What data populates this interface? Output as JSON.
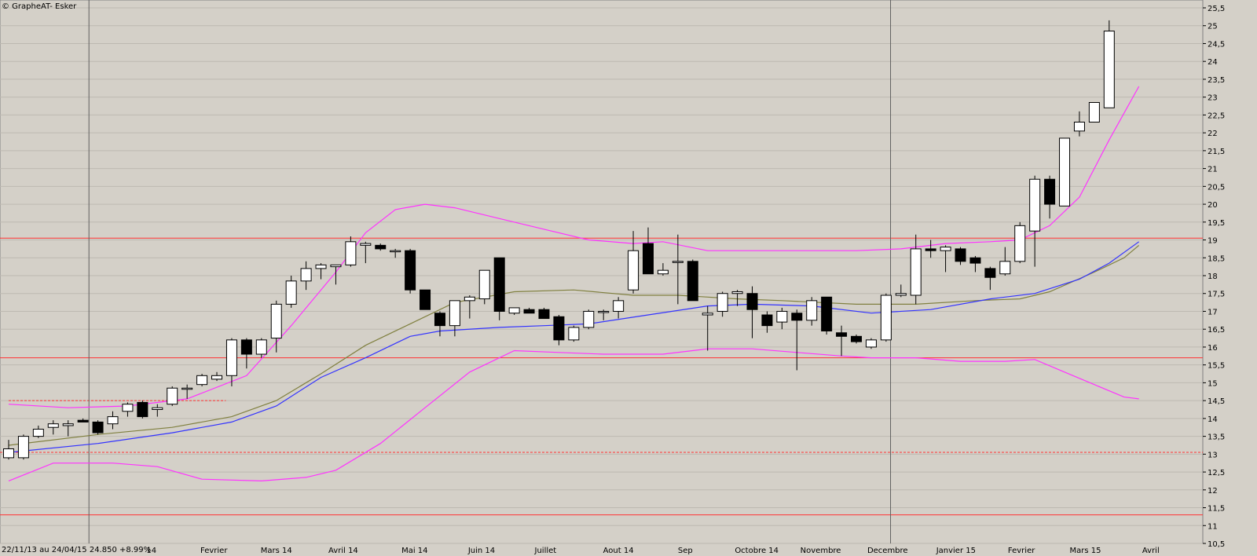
{
  "chart_data": {
    "type": "candlestick",
    "title": "© GrapheAT- Esker",
    "footer_info": "22/11/13 au 24/04/15  24.850  +8.99%",
    "ylim": [
      10.5,
      25.5
    ],
    "y_tick_labels": [
      "10,5",
      "11",
      "11,5",
      "12",
      "12,5",
      "13",
      "13,5",
      "14",
      "14,5",
      "15",
      "15,5",
      "16",
      "16,5",
      "17",
      "17,5",
      "18",
      "18,5",
      "19",
      "19,5",
      "20",
      "20,5",
      "21",
      "21,5",
      "22",
      "22,5",
      "23",
      "23,5",
      "24",
      "24,5",
      "25",
      "25,5"
    ],
    "y_ticks": [
      10.5,
      11,
      11.5,
      12,
      12.5,
      13,
      13.5,
      14,
      14.5,
      15,
      15.5,
      16,
      16.5,
      17,
      17.5,
      18,
      18.5,
      19,
      19.5,
      20,
      20.5,
      21,
      21.5,
      22,
      22.5,
      23,
      23.5,
      24,
      24.5,
      25,
      25.5
    ],
    "x_tick_labels": [
      "14",
      "Fevrier",
      "Mars 14",
      "Avril 14",
      "Mai 14",
      "Juin 14",
      "Juillet",
      "Aout 14",
      "Sep",
      "Octobre 14",
      "Novembre",
      "Decembre",
      "Janvier 15",
      "Fevrier",
      "Mars 15",
      "Avril"
    ],
    "x_tick_index": [
      9.6,
      13.8,
      18,
      22.5,
      27.3,
      31.8,
      36.1,
      41,
      45.5,
      50.3,
      54.6,
      59.1,
      63.7,
      68.1,
      72.4,
      76.8
    ],
    "grid": true,
    "colors": {
      "background": "#d4d0c8",
      "grid": "#bdb9b1",
      "up_candle": "#ffffff",
      "down_candle": "#000000",
      "bollinger": "#ff33ff",
      "ma_short": "#3333ff",
      "ma_long": "#808040",
      "support_line": "#ff3333",
      "separator": "#606060"
    },
    "candles": [
      {
        "o": 12.9,
        "h": 13.4,
        "l": 12.85,
        "c": 13.15
      },
      {
        "o": 12.9,
        "h": 13.55,
        "l": 12.85,
        "c": 13.5
      },
      {
        "o": 13.5,
        "h": 13.8,
        "l": 13.45,
        "c": 13.7
      },
      {
        "o": 13.75,
        "h": 13.95,
        "l": 13.55,
        "c": 13.85
      },
      {
        "o": 13.8,
        "h": 13.95,
        "l": 13.5,
        "c": 13.85
      },
      {
        "o": 13.95,
        "h": 14.0,
        "l": 13.9,
        "c": 13.9
      },
      {
        "o": 13.9,
        "h": 13.95,
        "l": 13.55,
        "c": 13.6
      },
      {
        "o": 13.85,
        "h": 14.2,
        "l": 13.7,
        "c": 14.05
      },
      {
        "o": 14.2,
        "h": 14.45,
        "l": 14.05,
        "c": 14.4
      },
      {
        "o": 14.45,
        "h": 14.5,
        "l": 14.0,
        "c": 14.05
      },
      {
        "o": 14.25,
        "h": 14.4,
        "l": 14.05,
        "c": 14.3
      },
      {
        "o": 14.4,
        "h": 14.9,
        "l": 14.35,
        "c": 14.85
      },
      {
        "o": 14.85,
        "h": 14.95,
        "l": 14.55,
        "c": 14.85
      },
      {
        "o": 14.95,
        "h": 15.25,
        "l": 14.9,
        "c": 15.2
      },
      {
        "o": 15.1,
        "h": 15.3,
        "l": 15.05,
        "c": 15.2
      },
      {
        "o": 15.2,
        "h": 16.25,
        "l": 14.9,
        "c": 16.2
      },
      {
        "o": 16.2,
        "h": 16.25,
        "l": 15.4,
        "c": 15.8
      },
      {
        "o": 15.8,
        "h": 16.25,
        "l": 15.7,
        "c": 16.2
      },
      {
        "o": 16.25,
        "h": 17.3,
        "l": 15.85,
        "c": 17.2
      },
      {
        "o": 17.2,
        "h": 18.0,
        "l": 17.1,
        "c": 17.85
      },
      {
        "o": 17.85,
        "h": 18.4,
        "l": 17.6,
        "c": 18.2
      },
      {
        "o": 18.2,
        "h": 18.35,
        "l": 17.9,
        "c": 18.3
      },
      {
        "o": 18.25,
        "h": 18.3,
        "l": 17.75,
        "c": 18.3
      },
      {
        "o": 18.3,
        "h": 19.1,
        "l": 18.25,
        "c": 18.95
      },
      {
        "o": 18.85,
        "h": 18.95,
        "l": 18.35,
        "c": 18.9
      },
      {
        "o": 18.85,
        "h": 18.9,
        "l": 18.7,
        "c": 18.75
      },
      {
        "o": 18.7,
        "h": 18.75,
        "l": 18.5,
        "c": 18.7
      },
      {
        "o": 18.7,
        "h": 18.75,
        "l": 17.5,
        "c": 17.6
      },
      {
        "o": 17.6,
        "h": 17.6,
        "l": 17.05,
        "c": 17.05
      },
      {
        "o": 16.95,
        "h": 17.0,
        "l": 16.3,
        "c": 16.6
      },
      {
        "o": 16.6,
        "h": 17.3,
        "l": 16.3,
        "c": 17.3
      },
      {
        "o": 17.3,
        "h": 17.45,
        "l": 16.8,
        "c": 17.4
      },
      {
        "o": 17.35,
        "h": 18.15,
        "l": 17.2,
        "c": 18.15
      },
      {
        "o": 18.5,
        "h": 18.5,
        "l": 16.75,
        "c": 17.0
      },
      {
        "o": 16.95,
        "h": 17.1,
        "l": 16.9,
        "c": 17.1
      },
      {
        "o": 17.05,
        "h": 17.1,
        "l": 16.95,
        "c": 16.95
      },
      {
        "o": 17.05,
        "h": 17.1,
        "l": 16.8,
        "c": 16.8
      },
      {
        "o": 16.85,
        "h": 16.9,
        "l": 16.05,
        "c": 16.2
      },
      {
        "o": 16.2,
        "h": 16.6,
        "l": 16.15,
        "c": 16.55
      },
      {
        "o": 16.55,
        "h": 17.05,
        "l": 16.5,
        "c": 17.0
      },
      {
        "o": 17.0,
        "h": 17.05,
        "l": 16.75,
        "c": 17.0
      },
      {
        "o": 17.0,
        "h": 17.4,
        "l": 16.8,
        "c": 17.3
      },
      {
        "o": 17.6,
        "h": 19.25,
        "l": 17.5,
        "c": 18.7
      },
      {
        "o": 18.9,
        "h": 19.35,
        "l": 18.05,
        "c": 18.05
      },
      {
        "o": 18.05,
        "h": 18.35,
        "l": 18.0,
        "c": 18.15
      },
      {
        "o": 18.4,
        "h": 19.15,
        "l": 17.2,
        "c": 18.4
      },
      {
        "o": 18.4,
        "h": 18.45,
        "l": 17.3,
        "c": 17.3
      },
      {
        "o": 16.9,
        "h": 17.15,
        "l": 15.9,
        "c": 16.95
      },
      {
        "o": 17.0,
        "h": 17.55,
        "l": 16.85,
        "c": 17.5
      },
      {
        "o": 17.5,
        "h": 17.6,
        "l": 17.15,
        "c": 17.55
      },
      {
        "o": 17.5,
        "h": 17.7,
        "l": 16.25,
        "c": 17.05
      },
      {
        "o": 16.9,
        "h": 17.0,
        "l": 16.4,
        "c": 16.6
      },
      {
        "o": 16.7,
        "h": 17.1,
        "l": 16.5,
        "c": 17.0
      },
      {
        "o": 16.95,
        "h": 17.05,
        "l": 15.35,
        "c": 16.75
      },
      {
        "o": 16.75,
        "h": 17.4,
        "l": 16.6,
        "c": 17.3
      },
      {
        "o": 17.4,
        "h": 17.4,
        "l": 16.35,
        "c": 16.45
      },
      {
        "o": 16.4,
        "h": 16.6,
        "l": 15.75,
        "c": 16.3
      },
      {
        "o": 16.3,
        "h": 16.35,
        "l": 16.1,
        "c": 16.15
      },
      {
        "o": 16.0,
        "h": 16.25,
        "l": 15.95,
        "c": 16.2
      },
      {
        "o": 16.2,
        "h": 17.5,
        "l": 16.15,
        "c": 17.45
      },
      {
        "o": 17.45,
        "h": 17.75,
        "l": 17.4,
        "c": 17.5
      },
      {
        "o": 17.45,
        "h": 19.15,
        "l": 17.2,
        "c": 18.75
      },
      {
        "o": 18.75,
        "h": 19.0,
        "l": 18.5,
        "c": 18.7
      },
      {
        "o": 18.7,
        "h": 18.85,
        "l": 18.1,
        "c": 18.8
      },
      {
        "o": 18.75,
        "h": 18.8,
        "l": 18.3,
        "c": 18.4
      },
      {
        "o": 18.5,
        "h": 18.55,
        "l": 18.1,
        "c": 18.35
      },
      {
        "o": 18.2,
        "h": 18.25,
        "l": 17.6,
        "c": 17.95
      },
      {
        "o": 18.05,
        "h": 18.8,
        "l": 18.0,
        "c": 18.4
      },
      {
        "o": 18.4,
        "h": 19.5,
        "l": 18.35,
        "c": 19.4
      },
      {
        "o": 19.25,
        "h": 20.8,
        "l": 18.25,
        "c": 20.7
      },
      {
        "o": 20.7,
        "h": 20.8,
        "l": 19.6,
        "c": 20.0
      },
      {
        "o": 19.95,
        "h": 21.85,
        "l": 19.95,
        "c": 21.85
      },
      {
        "o": 22.05,
        "h": 22.6,
        "l": 21.9,
        "c": 22.3
      },
      {
        "o": 22.3,
        "h": 22.85,
        "l": 22.3,
        "c": 22.85
      },
      {
        "o": 22.7,
        "h": 25.15,
        "l": 22.7,
        "c": 24.85
      }
    ],
    "bollinger_upper": [
      [
        0,
        14.4
      ],
      [
        4,
        14.3
      ],
      [
        8,
        14.35
      ],
      [
        12,
        14.55
      ],
      [
        16,
        15.2
      ],
      [
        19,
        16.6
      ],
      [
        22,
        18.1
      ],
      [
        24,
        19.2
      ],
      [
        26,
        19.85
      ],
      [
        28,
        20.0
      ],
      [
        30,
        19.9
      ],
      [
        33,
        19.6
      ],
      [
        36,
        19.3
      ],
      [
        39,
        19.0
      ],
      [
        42,
        18.9
      ],
      [
        44,
        18.95
      ],
      [
        47,
        18.7
      ],
      [
        52,
        18.7
      ],
      [
        57,
        18.7
      ],
      [
        60,
        18.75
      ],
      [
        63,
        18.9
      ],
      [
        66,
        18.95
      ],
      [
        68,
        19.0
      ],
      [
        70,
        19.4
      ],
      [
        72,
        20.2
      ],
      [
        74,
        21.8
      ],
      [
        76,
        23.3
      ]
    ],
    "bollinger_lower": [
      [
        0,
        12.25
      ],
      [
        3,
        12.75
      ],
      [
        7,
        12.75
      ],
      [
        10,
        12.65
      ],
      [
        13,
        12.3
      ],
      [
        17,
        12.25
      ],
      [
        20,
        12.35
      ],
      [
        22,
        12.55
      ],
      [
        25,
        13.3
      ],
      [
        28,
        14.3
      ],
      [
        31,
        15.3
      ],
      [
        34,
        15.9
      ],
      [
        37,
        15.85
      ],
      [
        40,
        15.8
      ],
      [
        44,
        15.8
      ],
      [
        47,
        15.95
      ],
      [
        50,
        15.95
      ],
      [
        53,
        15.85
      ],
      [
        56,
        15.75
      ],
      [
        58,
        15.7
      ],
      [
        61,
        15.7
      ],
      [
        64,
        15.6
      ],
      [
        67,
        15.6
      ],
      [
        69,
        15.65
      ],
      [
        71,
        15.3
      ],
      [
        73,
        14.95
      ],
      [
        75,
        14.6
      ],
      [
        76,
        14.55
      ]
    ],
    "ma_short": [
      [
        0,
        13.05
      ],
      [
        6,
        13.3
      ],
      [
        11,
        13.6
      ],
      [
        15,
        13.9
      ],
      [
        18,
        14.35
      ],
      [
        21,
        15.15
      ],
      [
        24,
        15.7
      ],
      [
        27,
        16.3
      ],
      [
        29,
        16.45
      ],
      [
        33,
        16.55
      ],
      [
        36,
        16.6
      ],
      [
        39,
        16.65
      ],
      [
        43,
        16.9
      ],
      [
        47,
        17.15
      ],
      [
        50,
        17.2
      ],
      [
        54,
        17.15
      ],
      [
        58,
        16.95
      ],
      [
        62,
        17.05
      ],
      [
        66,
        17.35
      ],
      [
        69,
        17.5
      ],
      [
        72,
        17.9
      ],
      [
        74,
        18.35
      ],
      [
        76,
        18.95
      ]
    ],
    "ma_long": [
      [
        0,
        13.25
      ],
      [
        6,
        13.55
      ],
      [
        11,
        13.75
      ],
      [
        15,
        14.05
      ],
      [
        18,
        14.5
      ],
      [
        21,
        15.25
      ],
      [
        24,
        16.05
      ],
      [
        27,
        16.65
      ],
      [
        30,
        17.25
      ],
      [
        34,
        17.55
      ],
      [
        38,
        17.6
      ],
      [
        42,
        17.45
      ],
      [
        45,
        17.45
      ],
      [
        49,
        17.35
      ],
      [
        52,
        17.3
      ],
      [
        57,
        17.2
      ],
      [
        61,
        17.2
      ],
      [
        65,
        17.3
      ],
      [
        68,
        17.35
      ],
      [
        70,
        17.55
      ],
      [
        73,
        18.1
      ],
      [
        75,
        18.5
      ],
      [
        76,
        18.85
      ]
    ],
    "horizontal_lines": [
      {
        "value": 19.05,
        "style": "solid"
      },
      {
        "value": 15.7,
        "style": "solid"
      },
      {
        "value": 11.3,
        "style": "solid"
      },
      {
        "value": 13.05,
        "style": "dashed",
        "full": true
      },
      {
        "value": 14.5,
        "style": "dashed",
        "full": false,
        "end_index": 14.6
      }
    ],
    "separators_index": [
      5.4,
      59.3
    ]
  }
}
